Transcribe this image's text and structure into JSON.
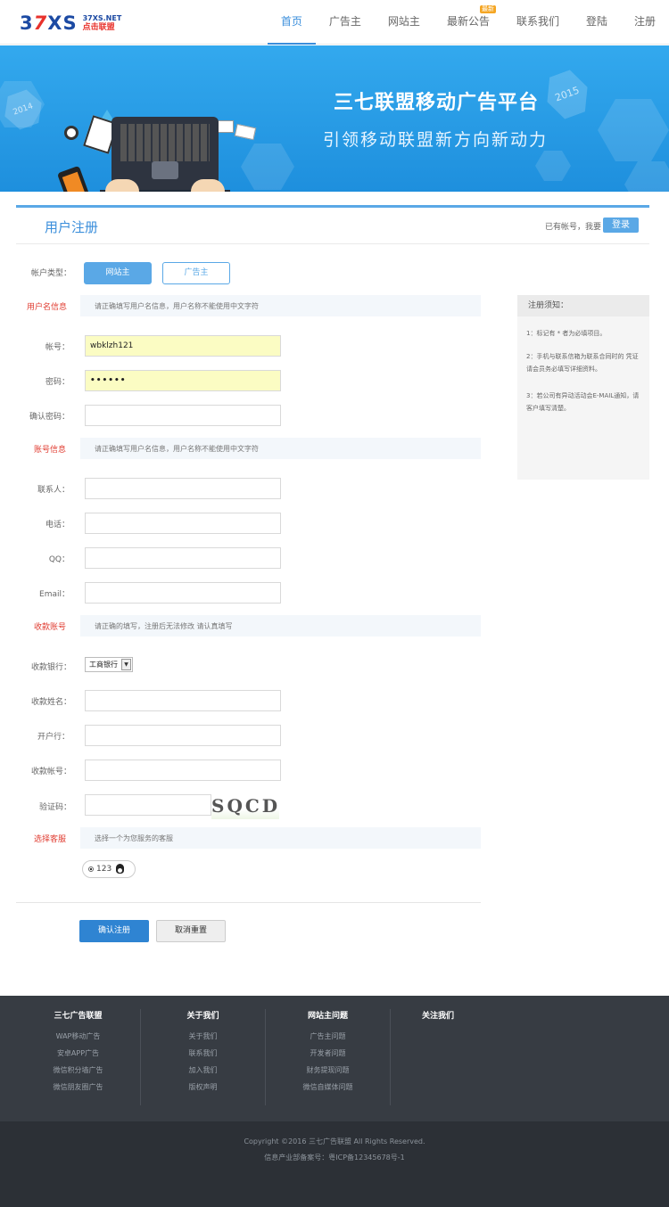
{
  "logo": {
    "big_prefix": "3",
    "big_seven": "7",
    "big_suffix": "XS",
    "domain": "37XS.NET",
    "tagline": "点击联盟"
  },
  "nav": [
    {
      "label": "首页",
      "active": true
    },
    {
      "label": "广告主"
    },
    {
      "label": "网站主"
    },
    {
      "label": "最新公告",
      "badge": "最新"
    },
    {
      "label": "联系我们"
    },
    {
      "label": "登陆"
    },
    {
      "label": "注册"
    }
  ],
  "banner": {
    "title": "三七联盟移动广告平台",
    "subtitle": "引领移动联盟新方向新动力",
    "year_right": "2015",
    "year_left": "2014"
  },
  "panel": {
    "title": "用户注册",
    "has_account": "已有帐号，我要",
    "login_label": "登录"
  },
  "account_type": {
    "label": "帐户类型：",
    "options": [
      "网站主",
      "广告主"
    ],
    "selected": "网站主"
  },
  "sections": {
    "username": {
      "label": "用户名信息",
      "hint": "请正确填写用户名信息，用户名称不能使用中文字符"
    },
    "account": {
      "label": "账号信息",
      "hint": "请正确填写用户名信息，用户名称不能使用中文字符"
    },
    "payment": {
      "label": "收款账号",
      "hint": "请正确的填写，注册后无法修改 请认真填写"
    },
    "service": {
      "label": "选择客服",
      "hint": "选择一个为您服务的客服"
    }
  },
  "fields": {
    "username": {
      "label": "帐号：",
      "value": "wbklzh121"
    },
    "password": {
      "label": "密码：",
      "value": "••••••"
    },
    "confirm": {
      "label": "确认密码：",
      "value": ""
    },
    "contact": {
      "label": "联系人：",
      "value": ""
    },
    "phone": {
      "label": "电话：",
      "value": ""
    },
    "qq": {
      "label": "QQ：",
      "value": ""
    },
    "email": {
      "label": "Email：",
      "value": ""
    },
    "bank": {
      "label": "收款银行：",
      "value": "工商银行"
    },
    "payee": {
      "label": "收款姓名：",
      "value": ""
    },
    "branch": {
      "label": "开户行：",
      "value": ""
    },
    "bank_account": {
      "label": "收款帐号：",
      "value": ""
    },
    "captcha": {
      "label": "验证码：",
      "value": "",
      "image_text": "SQCD"
    }
  },
  "service_option": {
    "label": "123"
  },
  "buttons": {
    "submit": "确认注册",
    "reset": "取消重置"
  },
  "notice": {
    "title": "注册须知：",
    "items": [
      "1：标记有 * 者为必填项目。",
      "2：手机与联系信箱为联系合同时的 凭证 请会员务必填写详细资料。",
      "3：若公司有异动活动会E-MAIL通知，请客户填写清楚。"
    ]
  },
  "footer": {
    "columns": [
      {
        "title": "三七广告联盟",
        "links": [
          "WAP移动广告",
          "安卓APP广告",
          "微信积分墙广告",
          "微信朋友圈广告"
        ]
      },
      {
        "title": "关于我们",
        "links": [
          "关于我们",
          "联系我们",
          "加入我们",
          "版权声明"
        ]
      },
      {
        "title": "网站主问题",
        "links": [
          "广告主问题",
          "开发者问题",
          "财务提现问题",
          "微信自媒体问题"
        ]
      },
      {
        "title": "关注我们",
        "links": []
      }
    ],
    "copyright": "Copyright ©2016 三七广告联盟 All Rights Reserved.",
    "icp": "信息产业部备案号：粤ICP备12345678号-1"
  },
  "colors": {
    "accent": "#3a8edb",
    "primary_button": "#2f84d2",
    "section_label": "#e03c31",
    "footer": "#373c43"
  }
}
